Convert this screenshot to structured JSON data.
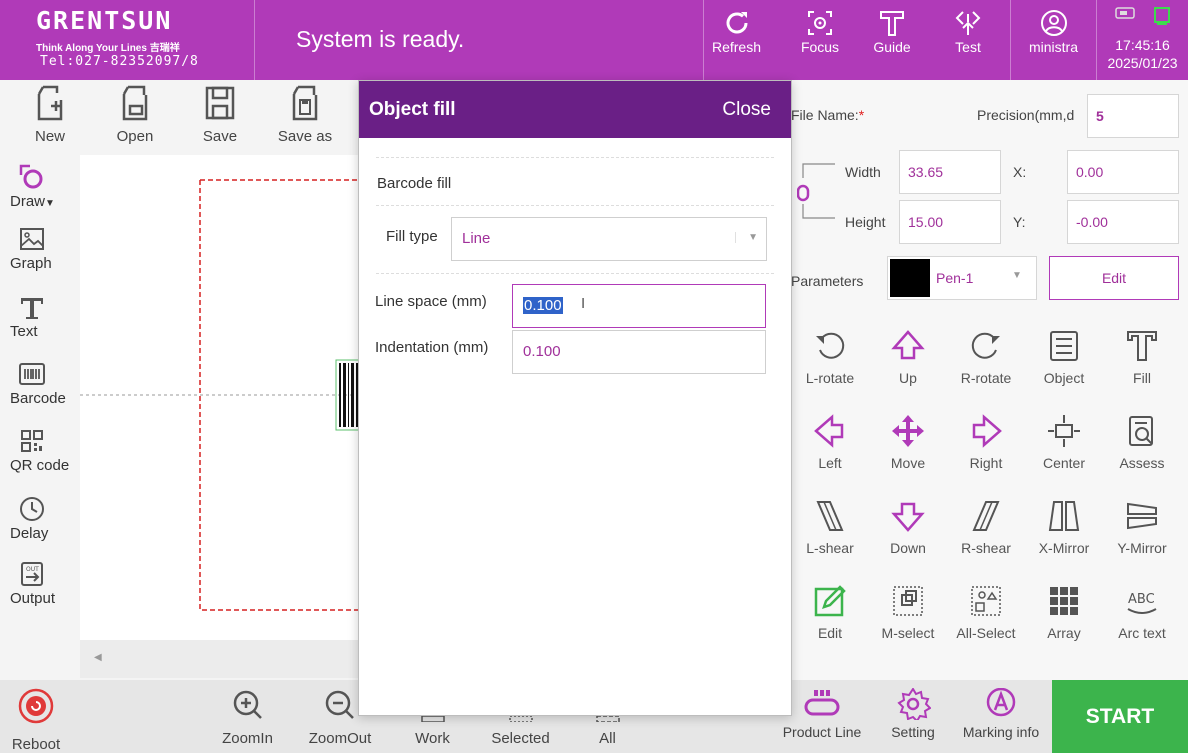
{
  "header": {
    "brand": "GRENTSUN",
    "tagline": "Think Along Your Lines 吉瑞祥",
    "tel": "Tel:027-82352097/8",
    "status": "System is ready.",
    "buttons": {
      "refresh": "Refresh",
      "focus": "Focus",
      "guide": "Guide",
      "test": "Test",
      "user": "ministra"
    },
    "time": "17:45:16",
    "date": "2025/01/23"
  },
  "file_ops": {
    "new": "New",
    "open": "Open",
    "save": "Save",
    "save_as": "Save as"
  },
  "left_tools": {
    "draw": "Draw",
    "graph": "Graph",
    "text": "Text",
    "barcode": "Barcode",
    "qrcode": "QR code",
    "delay": "Delay",
    "output": "Output"
  },
  "bottom": {
    "reboot": "Reboot",
    "zoomin": "ZoomIn",
    "zoomout": "ZoomOut",
    "work": "Work",
    "selected": "Selected",
    "all": "All"
  },
  "modal": {
    "title": "Object fill",
    "close": "Close",
    "section": "Barcode fill",
    "fill_type_label": "Fill type",
    "fill_type_value": "Line",
    "line_space_label": "Line space (mm)",
    "line_space_value": "0.100",
    "indentation_label": "Indentation (mm)",
    "indentation_value": "0.100"
  },
  "right_panel": {
    "file_name_label": "File Name:",
    "required_mark": "*",
    "precision_label": "Precision(mm,d",
    "precision_value": "5",
    "width_label": "Width",
    "width_value": "33.65",
    "height_label": "Height",
    "height_value": "15.00",
    "x_label": "X:",
    "x_value": "0.00",
    "y_label": "Y:",
    "y_value": "-0.00",
    "parameters_label": "Parameters",
    "pen_value": "Pen-1",
    "edit_param": "Edit",
    "tools": {
      "l_rotate": "L-rotate",
      "up": "Up",
      "r_rotate": "R-rotate",
      "object": "Object",
      "fill": "Fill",
      "left": "Left",
      "move": "Move",
      "right": "Right",
      "center": "Center",
      "assess": "Assess",
      "l_shear": "L-shear",
      "down": "Down",
      "r_shear": "R-shear",
      "x_mirror": "X-Mirror",
      "y_mirror": "Y-Mirror",
      "edit": "Edit",
      "m_select": "M-select",
      "all_select": "All-Select",
      "array": "Array",
      "arc_text": "Arc text"
    }
  },
  "right_bottom": {
    "product_line": "Product Line",
    "setting": "Setting",
    "marking_info": "Marking info",
    "start": "START"
  },
  "colors": {
    "header": "#b03ab8",
    "modal_header": "#6a1f86",
    "accent_text": "#a0309a",
    "start": "#3cb44c",
    "icon_accent": "#b03ab8"
  }
}
